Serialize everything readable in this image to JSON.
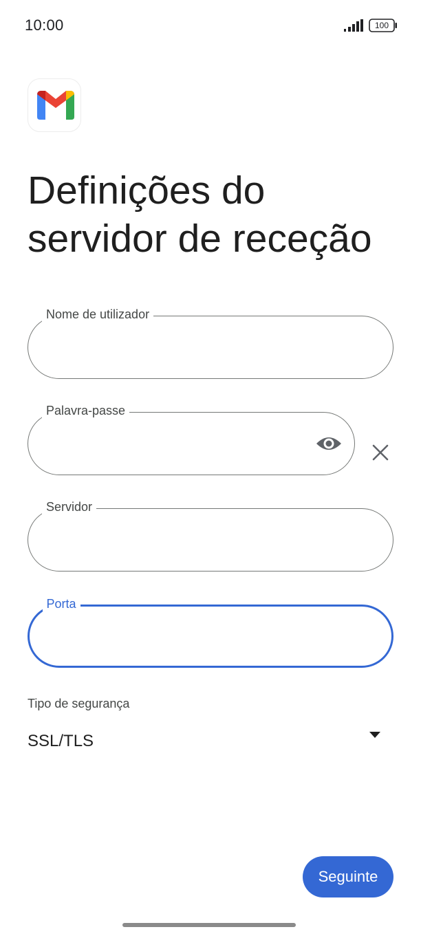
{
  "status_bar": {
    "time": "10:00",
    "battery": "100",
    "signal_icon": "signal-bars-icon",
    "battery_icon": "battery-icon"
  },
  "app": {
    "logo_icon": "gmail-logo-icon"
  },
  "page": {
    "title": "Definições do servidor de receção"
  },
  "form": {
    "username": {
      "label": "Nome de utilizador",
      "value": ""
    },
    "password": {
      "label": "Palavra-passe",
      "value": "",
      "eye_icon": "eye-icon",
      "clear_icon": "close-icon"
    },
    "server": {
      "label": "Servidor",
      "value": ""
    },
    "port": {
      "label": "Porta",
      "value": "",
      "focused": true
    },
    "security": {
      "label": "Tipo de segurança",
      "selected": "SSL/TLS",
      "dropdown_icon": "dropdown-arrow-icon"
    }
  },
  "actions": {
    "next_label": "Seguinte"
  },
  "colors": {
    "accent": "#3468d4",
    "outline": "#747775",
    "label": "#444746",
    "text": "#1f1f1f"
  }
}
